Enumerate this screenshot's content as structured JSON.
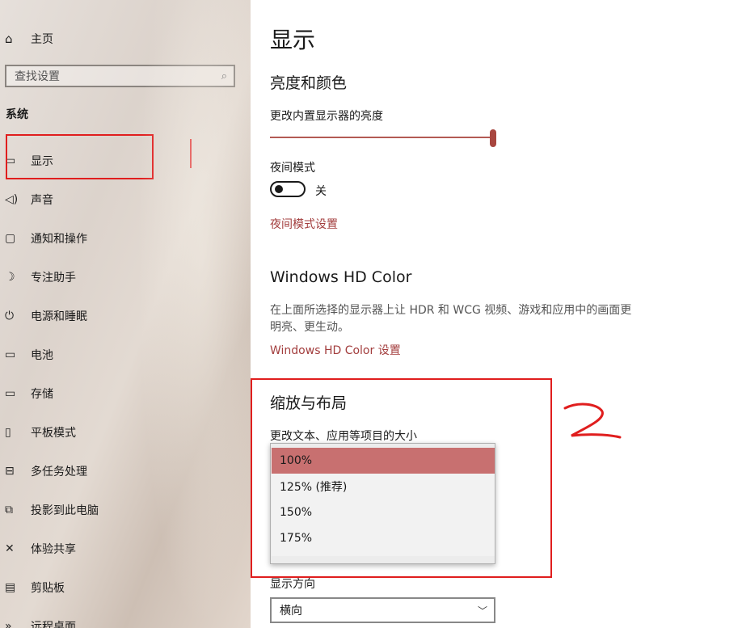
{
  "sidebar": {
    "home_label": "主页",
    "search_placeholder": "查找设置",
    "section_title": "系统",
    "items": [
      {
        "label": "显示",
        "icon": "monitor-icon"
      },
      {
        "label": "声音",
        "icon": "speaker-icon"
      },
      {
        "label": "通知和操作",
        "icon": "notification-icon"
      },
      {
        "label": "专注助手",
        "icon": "moon-icon"
      },
      {
        "label": "电源和睡眠",
        "icon": "power-icon"
      },
      {
        "label": "电池",
        "icon": "battery-icon"
      },
      {
        "label": "存储",
        "icon": "storage-icon"
      },
      {
        "label": "平板模式",
        "icon": "tablet-icon"
      },
      {
        "label": "多任务处理",
        "icon": "multitask-icon"
      },
      {
        "label": "投影到此电脑",
        "icon": "project-icon"
      },
      {
        "label": "体验共享",
        "icon": "share-icon"
      },
      {
        "label": "剪贴板",
        "icon": "clipboard-icon"
      },
      {
        "label": "远程桌面",
        "icon": "remote-desktop-icon"
      }
    ]
  },
  "main": {
    "title": "显示",
    "brightness": {
      "heading": "亮度和颜色",
      "label": "更改内置显示器的亮度",
      "value_fraction": 1.0
    },
    "night_light": {
      "label": "夜间模式",
      "state": "关",
      "link": "夜间模式设置"
    },
    "hdr": {
      "heading": "Windows HD Color",
      "description": "在上面所选择的显示器上让 HDR 和 WCG 视频、游戏和应用中的画面更明亮、更生动。",
      "link": "Windows HD Color 设置"
    },
    "scale": {
      "heading": "缩放与布局",
      "label": "更改文本、应用等项目的大小",
      "options": [
        "100%",
        "125% (推荐)",
        "150%",
        "175%"
      ],
      "selected": "100%"
    },
    "orientation": {
      "label": "显示方向",
      "value": "横向"
    }
  },
  "colors": {
    "accent": "#a33e3e",
    "selected_option": "#c87070",
    "annotation": "#e01e1e"
  }
}
